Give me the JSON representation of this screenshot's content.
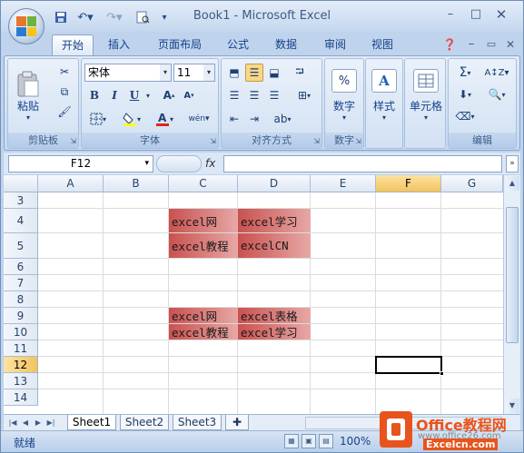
{
  "title": "Book1 - Microsoft Excel",
  "tabs": [
    "开始",
    "插入",
    "页面布局",
    "公式",
    "数据",
    "审阅",
    "视图"
  ],
  "ribbon": {
    "clipboard": {
      "label": "剪贴板",
      "paste": "粘贴"
    },
    "font": {
      "label": "字体",
      "name": "宋体",
      "size": "11",
      "bold": "B",
      "italic": "I",
      "underline": "U"
    },
    "alignment": {
      "label": "对齐方式"
    },
    "number": {
      "label": "数字",
      "btn": "数字"
    },
    "styles": {
      "btn": "样式"
    },
    "cells": {
      "btn": "单元格"
    },
    "editing": {
      "label": "编辑"
    }
  },
  "formula_bar": {
    "name_box": "F12",
    "fx": "fx",
    "value": ""
  },
  "columns": [
    "A",
    "B",
    "C",
    "D",
    "E",
    "F",
    "G"
  ],
  "selected_column": "F",
  "rows": [
    "3",
    "4",
    "5",
    "6",
    "7",
    "8",
    "9",
    "10",
    "11",
    "12",
    "13",
    "14"
  ],
  "selected_row": "12",
  "cells": {
    "C4": "excel网",
    "D4": "excel学习",
    "C5": "excel教程",
    "D5": "excelCN",
    "C9": "excel网",
    "D9": "excel表格",
    "C10": "excel教程",
    "D10": "excel学习"
  },
  "sheet_tabs": [
    "Sheet1",
    "Sheet2",
    "Sheet3"
  ],
  "active_sheet": "Sheet1",
  "status": {
    "ready": "就绪",
    "zoom": "100%"
  },
  "watermark": {
    "brand": "Office教程网",
    "url": "www.office26.com",
    "sub": "Excelcn.com"
  },
  "colors": {
    "cell_fill_dark": "#c9514f",
    "cell_fill_light": "#e7a8a6",
    "selected_header": "#f4c35d",
    "ribbon": "#c6d9f1"
  }
}
